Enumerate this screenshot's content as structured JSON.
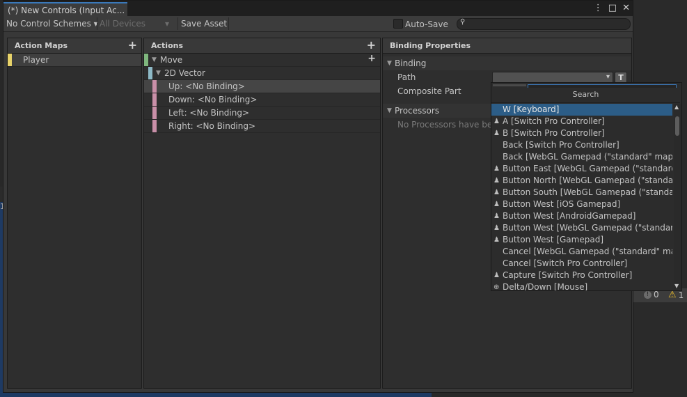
{
  "window": {
    "tab_title": "(*) New Controls (Input Ac...",
    "menu_icon": "⋮",
    "maximize_icon": "□",
    "close_icon": "✕"
  },
  "toolbar": {
    "control_schemes": "No Control Schemes ▾",
    "devices": "All Devices",
    "devices_arrow": "▾",
    "save_asset": "Save Asset",
    "auto_save": "Auto-Save",
    "search_icon": "search-icon"
  },
  "action_maps": {
    "header": "Action Maps",
    "add": "+",
    "items": [
      {
        "label": "Player",
        "color": "#e8d36a"
      }
    ]
  },
  "actions": {
    "header": "Actions",
    "add": "+",
    "move": {
      "label": "Move",
      "color": "#7fb77e",
      "add": "+"
    },
    "composite": {
      "label": "2D Vector",
      "color": "#8db9c6"
    },
    "bindings": [
      {
        "label": "Up: <No Binding>",
        "color": "#c98fa8"
      },
      {
        "label": "Down: <No Binding>",
        "color": "#c98fa8"
      },
      {
        "label": "Left: <No Binding>",
        "color": "#c98fa8"
      },
      {
        "label": "Right: <No Binding>",
        "color": "#c98fa8"
      }
    ]
  },
  "binding_properties": {
    "header": "Binding Properties",
    "binding_section": "Binding",
    "path_label": "Path",
    "path_dropdown_arrow": "▾",
    "t_button": "T",
    "composite_part_label": "Composite Part",
    "processors_section": "Processors",
    "no_processors": "No Processors have bee"
  },
  "dropdown": {
    "title": "Search",
    "items": [
      {
        "label": "W [Keyboard]",
        "icon": "",
        "selected": true
      },
      {
        "label": "A [Switch Pro Controller]",
        "icon": "gamepad-icon"
      },
      {
        "label": "B [Switch Pro Controller]",
        "icon": "gamepad-icon"
      },
      {
        "label": "Back [Switch Pro Controller]",
        "icon": ""
      },
      {
        "label": "Back [WebGL Gamepad (\"standard\" mappin",
        "icon": ""
      },
      {
        "label": "Button East [WebGL Gamepad (\"standard\" m",
        "icon": "gamepad-icon"
      },
      {
        "label": "Button North [WebGL Gamepad (\"standard\"",
        "icon": "gamepad-icon"
      },
      {
        "label": "Button South [WebGL Gamepad (\"standard\"",
        "icon": "gamepad-icon"
      },
      {
        "label": "Button West [iOS Gamepad]",
        "icon": "gamepad-icon"
      },
      {
        "label": "Button West [AndroidGamepad]",
        "icon": "gamepad-icon"
      },
      {
        "label": "Button West [WebGL Gamepad (\"standard\" r",
        "icon": "gamepad-icon"
      },
      {
        "label": "Button West [Gamepad]",
        "icon": "gamepad-icon"
      },
      {
        "label": "Cancel [WebGL Gamepad (\"standard\" mapp",
        "icon": ""
      },
      {
        "label": "Cancel [Switch Pro Controller]",
        "icon": ""
      },
      {
        "label": "Capture [Switch Pro Controller]",
        "icon": "gamepad-icon"
      },
      {
        "label": "Delta/Down [Mouse]",
        "icon": "mouse-icon"
      }
    ]
  },
  "background": {
    "errors": "0",
    "warnings": "1",
    "edge_digit": "1"
  }
}
